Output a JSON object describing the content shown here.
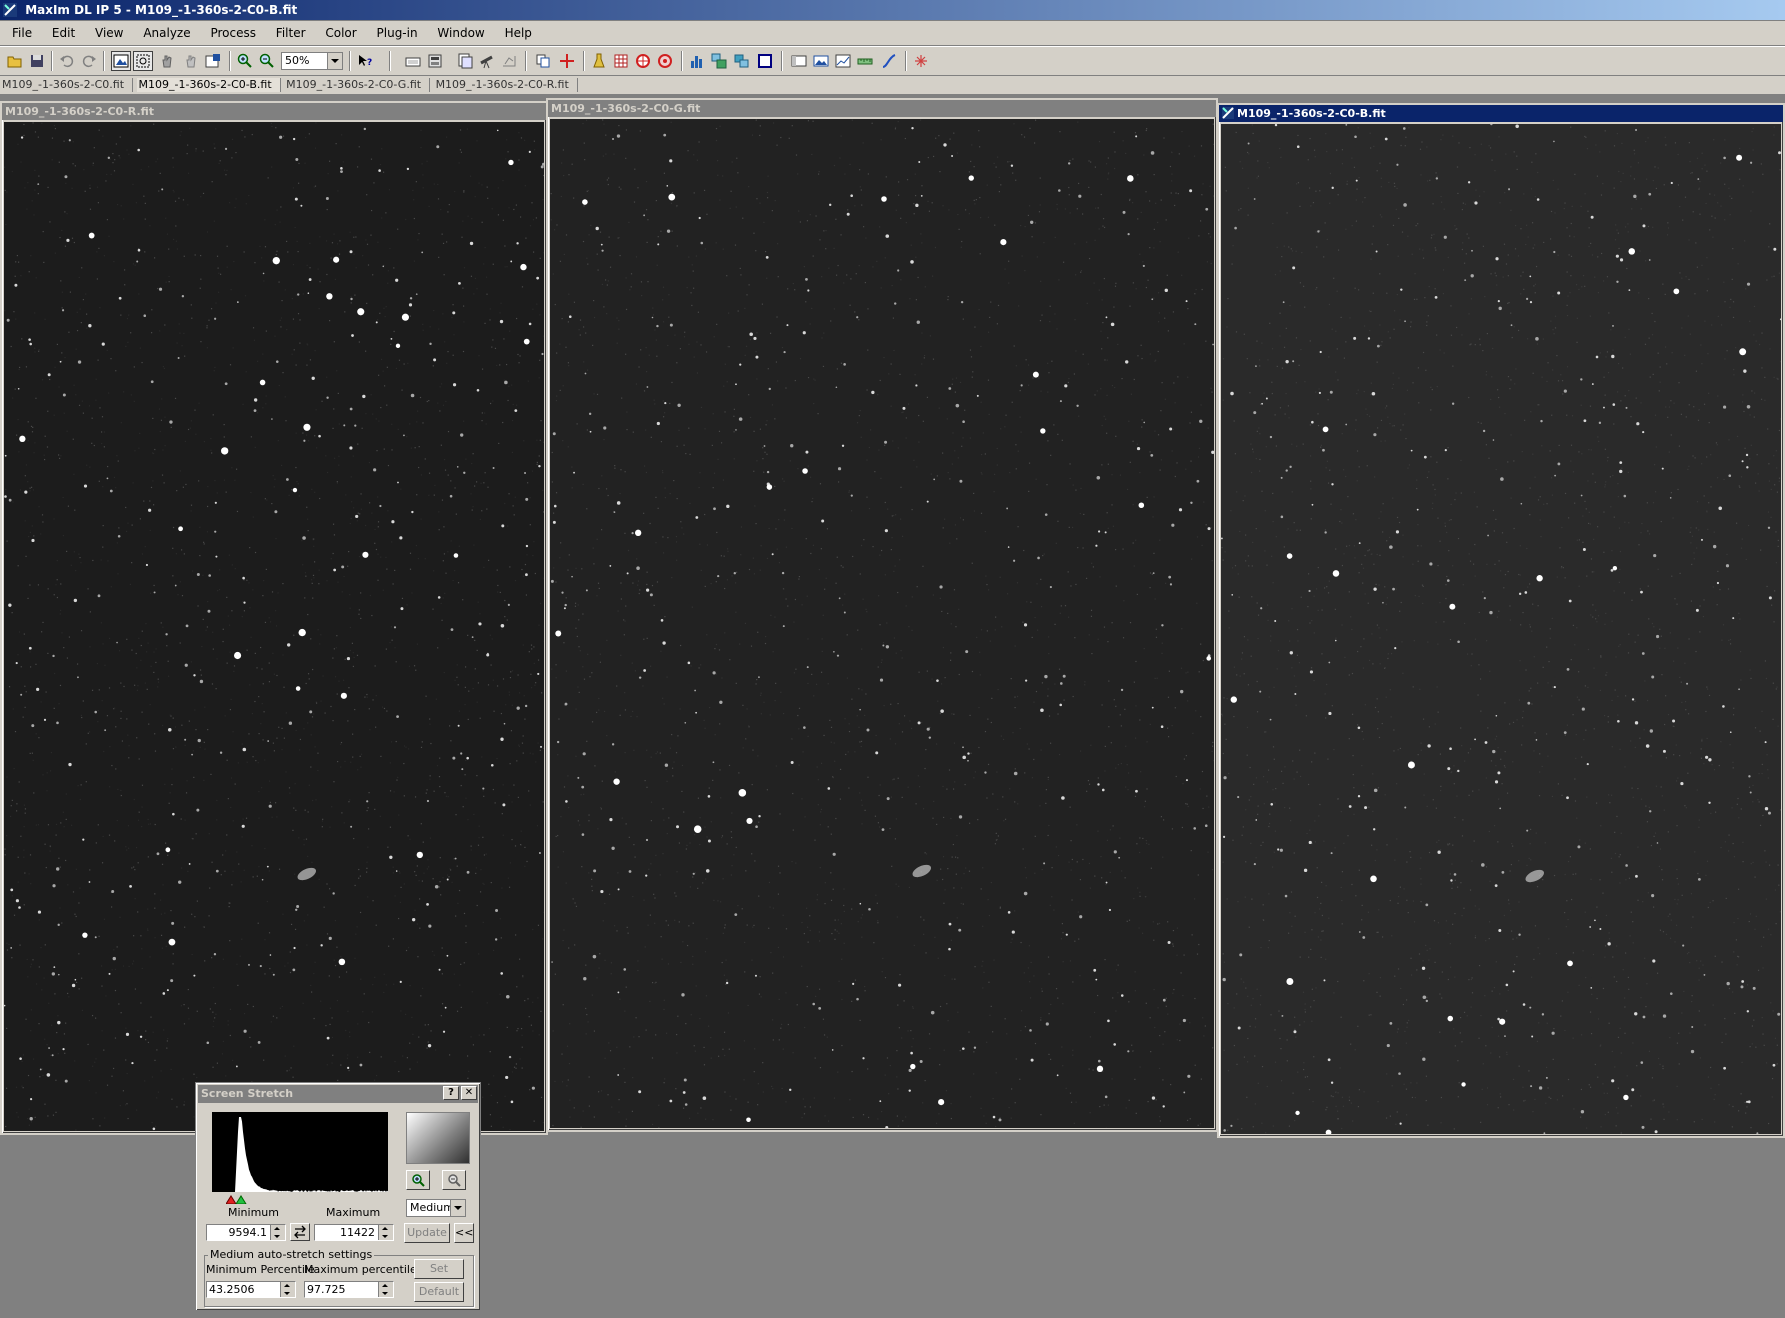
{
  "window": {
    "title": "MaxIm DL IP 5 - M109_-1-360s-2-C0-B.fit"
  },
  "menu": [
    "File",
    "Edit",
    "View",
    "Analyze",
    "Process",
    "Filter",
    "Color",
    "Plug-in",
    "Window",
    "Help"
  ],
  "toolbar": {
    "zoom_value": "50%"
  },
  "tabs": [
    {
      "label": "M109_-1-360s-2-C0.fit",
      "active": false
    },
    {
      "label": "M109_-1-360s-2-C0-B.fit",
      "active": true
    },
    {
      "label": "M109_-1-360s-2-C0-G.fit",
      "active": false
    },
    {
      "label": "M109_-1-360s-2-C0-R.fit",
      "active": false
    }
  ],
  "image_windows": [
    {
      "title": "M109_-1-360s-2-C0-R.fit",
      "active": false
    },
    {
      "title": "M109_-1-360s-2-C0-G.fit",
      "active": false
    },
    {
      "title": "M109_-1-360s-2-C0-B.fit",
      "active": true
    }
  ],
  "screen_stretch": {
    "title": "Screen Stretch",
    "help_label": "?",
    "close_label": "✕",
    "minimum_label": "Minimum",
    "maximum_label": "Maximum",
    "minimum_value": "9594.1",
    "maximum_value": "11422",
    "mode": "Medium",
    "update_label": "Update",
    "collapse_label": "<<",
    "group_title": "Medium auto-stretch settings",
    "min_percentile_label": "Minimum Percentile",
    "max_percentile_label": "Maximum percentile",
    "min_percentile_value": "43.2506",
    "max_percentile_value": "97.725",
    "set_label": "Set",
    "default_label": "Default"
  },
  "colors": {
    "title_active": "#0a246a",
    "title_inactive": "#808080",
    "chrome": "#d4d0c8",
    "workspace": "#808080"
  }
}
